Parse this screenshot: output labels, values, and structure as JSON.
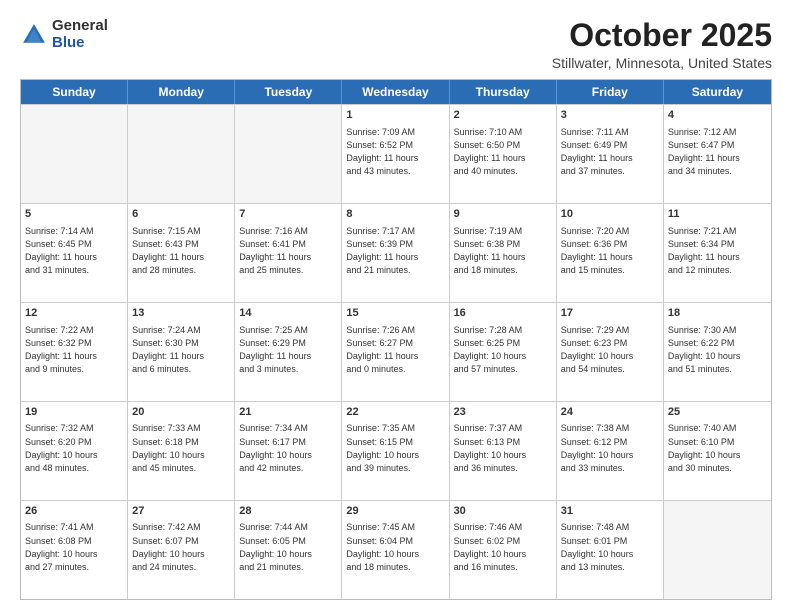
{
  "logo": {
    "general": "General",
    "blue": "Blue"
  },
  "header": {
    "month": "October 2025",
    "location": "Stillwater, Minnesota, United States"
  },
  "weekdays": [
    "Sunday",
    "Monday",
    "Tuesday",
    "Wednesday",
    "Thursday",
    "Friday",
    "Saturday"
  ],
  "weeks": [
    [
      {
        "day": "",
        "info": ""
      },
      {
        "day": "",
        "info": ""
      },
      {
        "day": "",
        "info": ""
      },
      {
        "day": "1",
        "info": "Sunrise: 7:09 AM\nSunset: 6:52 PM\nDaylight: 11 hours\nand 43 minutes."
      },
      {
        "day": "2",
        "info": "Sunrise: 7:10 AM\nSunset: 6:50 PM\nDaylight: 11 hours\nand 40 minutes."
      },
      {
        "day": "3",
        "info": "Sunrise: 7:11 AM\nSunset: 6:49 PM\nDaylight: 11 hours\nand 37 minutes."
      },
      {
        "day": "4",
        "info": "Sunrise: 7:12 AM\nSunset: 6:47 PM\nDaylight: 11 hours\nand 34 minutes."
      }
    ],
    [
      {
        "day": "5",
        "info": "Sunrise: 7:14 AM\nSunset: 6:45 PM\nDaylight: 11 hours\nand 31 minutes."
      },
      {
        "day": "6",
        "info": "Sunrise: 7:15 AM\nSunset: 6:43 PM\nDaylight: 11 hours\nand 28 minutes."
      },
      {
        "day": "7",
        "info": "Sunrise: 7:16 AM\nSunset: 6:41 PM\nDaylight: 11 hours\nand 25 minutes."
      },
      {
        "day": "8",
        "info": "Sunrise: 7:17 AM\nSunset: 6:39 PM\nDaylight: 11 hours\nand 21 minutes."
      },
      {
        "day": "9",
        "info": "Sunrise: 7:19 AM\nSunset: 6:38 PM\nDaylight: 11 hours\nand 18 minutes."
      },
      {
        "day": "10",
        "info": "Sunrise: 7:20 AM\nSunset: 6:36 PM\nDaylight: 11 hours\nand 15 minutes."
      },
      {
        "day": "11",
        "info": "Sunrise: 7:21 AM\nSunset: 6:34 PM\nDaylight: 11 hours\nand 12 minutes."
      }
    ],
    [
      {
        "day": "12",
        "info": "Sunrise: 7:22 AM\nSunset: 6:32 PM\nDaylight: 11 hours\nand 9 minutes."
      },
      {
        "day": "13",
        "info": "Sunrise: 7:24 AM\nSunset: 6:30 PM\nDaylight: 11 hours\nand 6 minutes."
      },
      {
        "day": "14",
        "info": "Sunrise: 7:25 AM\nSunset: 6:29 PM\nDaylight: 11 hours\nand 3 minutes."
      },
      {
        "day": "15",
        "info": "Sunrise: 7:26 AM\nSunset: 6:27 PM\nDaylight: 11 hours\nand 0 minutes."
      },
      {
        "day": "16",
        "info": "Sunrise: 7:28 AM\nSunset: 6:25 PM\nDaylight: 10 hours\nand 57 minutes."
      },
      {
        "day": "17",
        "info": "Sunrise: 7:29 AM\nSunset: 6:23 PM\nDaylight: 10 hours\nand 54 minutes."
      },
      {
        "day": "18",
        "info": "Sunrise: 7:30 AM\nSunset: 6:22 PM\nDaylight: 10 hours\nand 51 minutes."
      }
    ],
    [
      {
        "day": "19",
        "info": "Sunrise: 7:32 AM\nSunset: 6:20 PM\nDaylight: 10 hours\nand 48 minutes."
      },
      {
        "day": "20",
        "info": "Sunrise: 7:33 AM\nSunset: 6:18 PM\nDaylight: 10 hours\nand 45 minutes."
      },
      {
        "day": "21",
        "info": "Sunrise: 7:34 AM\nSunset: 6:17 PM\nDaylight: 10 hours\nand 42 minutes."
      },
      {
        "day": "22",
        "info": "Sunrise: 7:35 AM\nSunset: 6:15 PM\nDaylight: 10 hours\nand 39 minutes."
      },
      {
        "day": "23",
        "info": "Sunrise: 7:37 AM\nSunset: 6:13 PM\nDaylight: 10 hours\nand 36 minutes."
      },
      {
        "day": "24",
        "info": "Sunrise: 7:38 AM\nSunset: 6:12 PM\nDaylight: 10 hours\nand 33 minutes."
      },
      {
        "day": "25",
        "info": "Sunrise: 7:40 AM\nSunset: 6:10 PM\nDaylight: 10 hours\nand 30 minutes."
      }
    ],
    [
      {
        "day": "26",
        "info": "Sunrise: 7:41 AM\nSunset: 6:08 PM\nDaylight: 10 hours\nand 27 minutes."
      },
      {
        "day": "27",
        "info": "Sunrise: 7:42 AM\nSunset: 6:07 PM\nDaylight: 10 hours\nand 24 minutes."
      },
      {
        "day": "28",
        "info": "Sunrise: 7:44 AM\nSunset: 6:05 PM\nDaylight: 10 hours\nand 21 minutes."
      },
      {
        "day": "29",
        "info": "Sunrise: 7:45 AM\nSunset: 6:04 PM\nDaylight: 10 hours\nand 18 minutes."
      },
      {
        "day": "30",
        "info": "Sunrise: 7:46 AM\nSunset: 6:02 PM\nDaylight: 10 hours\nand 16 minutes."
      },
      {
        "day": "31",
        "info": "Sunrise: 7:48 AM\nSunset: 6:01 PM\nDaylight: 10 hours\nand 13 minutes."
      },
      {
        "day": "",
        "info": ""
      }
    ]
  ]
}
